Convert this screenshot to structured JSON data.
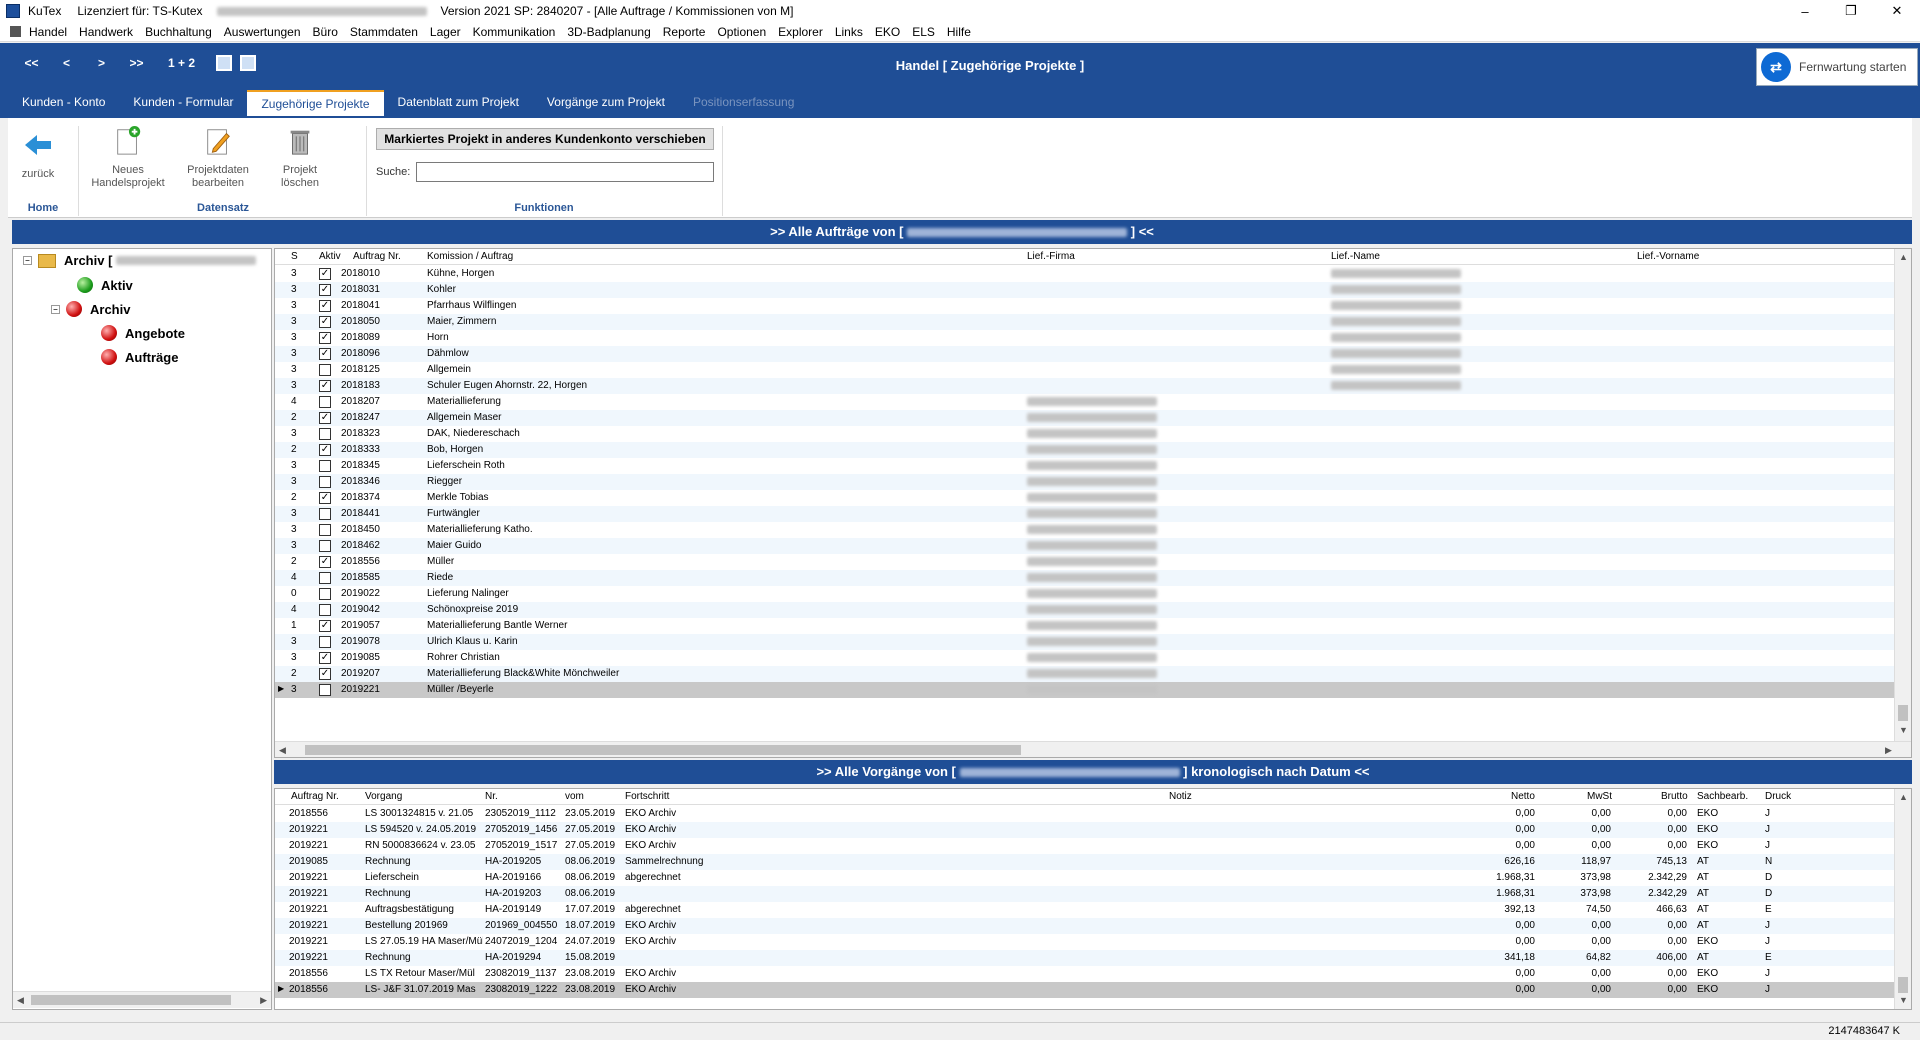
{
  "app": {
    "name": "KuTex",
    "license": "Lizenziert für: TS-Kutex",
    "version": "Version 2021 SP: 2840207 - [Alle Auftrage / Kommissionen von M]"
  },
  "menu": [
    "Handel",
    "Handwerk",
    "Buchhaltung",
    "Auswertungen",
    "Büro",
    "Stammdaten",
    "Lager",
    "Kommunikation",
    "3D-Badplanung",
    "Reporte",
    "Optionen",
    "Explorer",
    "Links",
    "EKO",
    "ELS",
    "Hilfe"
  ],
  "nav": {
    "first": "<<",
    "prev": "<",
    "next": ">",
    "last": ">>",
    "page": "1 + 2"
  },
  "header_title": "Handel   [ Zugehörige Projekte ]",
  "remote_label": "Fernwartung starten",
  "tabs": [
    {
      "label": "Kunden - Konto"
    },
    {
      "label": "Kunden - Formular"
    },
    {
      "label": "Zugehörige Projekte",
      "active": true
    },
    {
      "label": "Datenblatt zum Projekt"
    },
    {
      "label": "Vorgänge zum Projekt"
    },
    {
      "label": "Positionserfassung",
      "disabled": true
    }
  ],
  "ribbon": {
    "back": "zurück",
    "new_project": [
      "Neues",
      "Handelsprojekt"
    ],
    "edit_project": [
      "Projektdaten",
      "bearbeiten"
    ],
    "delete_project": [
      "Projekt",
      "löschen"
    ],
    "move_button": "Markiertes Projekt in anderes Kundenkonto verschieben",
    "search_label": "Suche:",
    "search_value": "",
    "groups": {
      "home": "Home",
      "record": "Datensatz",
      "functions": "Funktionen"
    }
  },
  "orders_header": {
    "prefix": ">> Alle Aufträge von [",
    "suffix": "] <<"
  },
  "tree": {
    "root": "Archiv [",
    "children": [
      "Aktiv",
      "Archiv"
    ],
    "archiv_children": [
      "Angebote",
      "Aufträge"
    ]
  },
  "orders": {
    "columns": [
      "S",
      "Aktiv",
      "Auftrag Nr.",
      "Komission / Auftrag",
      "Lief.-Firma",
      "Lief.-Name",
      "Lief.-Vorname"
    ],
    "rows": [
      {
        "s": "3",
        "aktiv": true,
        "nr": "2018010",
        "kom": "Kühne, Horgen",
        "redact": "name"
      },
      {
        "s": "3",
        "aktiv": true,
        "nr": "2018031",
        "kom": "Kohler",
        "redact": "name"
      },
      {
        "s": "3",
        "aktiv": true,
        "nr": "2018041",
        "kom": "Pfarrhaus Wilflingen",
        "redact": "name"
      },
      {
        "s": "3",
        "aktiv": true,
        "nr": "2018050",
        "kom": "Maier, Zimmern",
        "redact": "name"
      },
      {
        "s": "3",
        "aktiv": true,
        "nr": "2018089",
        "kom": "Horn",
        "redact": "name"
      },
      {
        "s": "3",
        "aktiv": true,
        "nr": "2018096",
        "kom": "Dähmlow",
        "redact": "name"
      },
      {
        "s": "3",
        "aktiv": false,
        "nr": "2018125",
        "kom": "Allgemein",
        "redact": "name"
      },
      {
        "s": "3",
        "aktiv": true,
        "nr": "2018183",
        "kom": "Schuler  Eugen Ahornstr. 22, Horgen",
        "redact": "name"
      },
      {
        "s": "4",
        "aktiv": false,
        "nr": "2018207",
        "kom": "Materiallieferung",
        "redact": "firma"
      },
      {
        "s": "2",
        "aktiv": true,
        "nr": "2018247",
        "kom": "Allgemein Maser",
        "redact": "firma"
      },
      {
        "s": "3",
        "aktiv": false,
        "nr": "2018323",
        "kom": "DAK, Niedereschach",
        "redact": "firma"
      },
      {
        "s": "2",
        "aktiv": true,
        "nr": "2018333",
        "kom": "Bob, Horgen",
        "redact": "firma"
      },
      {
        "s": "3",
        "aktiv": false,
        "nr": "2018345",
        "kom": "Lieferschein Roth",
        "redact": "firma"
      },
      {
        "s": "3",
        "aktiv": false,
        "nr": "2018346",
        "kom": "Riegger",
        "redact": "firma"
      },
      {
        "s": "2",
        "aktiv": true,
        "nr": "2018374",
        "kom": "Merkle Tobias",
        "redact": "firma"
      },
      {
        "s": "3",
        "aktiv": false,
        "nr": "2018441",
        "kom": "Furtwängler",
        "redact": "firma"
      },
      {
        "s": "3",
        "aktiv": false,
        "nr": "2018450",
        "kom": "Materiallieferung Katho.",
        "redact": "firma"
      },
      {
        "s": "3",
        "aktiv": false,
        "nr": "2018462",
        "kom": "Maier Guido",
        "redact": "firma"
      },
      {
        "s": "2",
        "aktiv": true,
        "nr": "2018556",
        "kom": "Müller",
        "redact": "firma"
      },
      {
        "s": "4",
        "aktiv": false,
        "nr": "2018585",
        "kom": "Riede",
        "redact": "firma"
      },
      {
        "s": "0",
        "aktiv": false,
        "nr": "2019022",
        "kom": "Lieferung Nalinger",
        "redact": "firma"
      },
      {
        "s": "4",
        "aktiv": false,
        "nr": "2019042",
        "kom": "Schönoxpreise 2019",
        "redact": "firma"
      },
      {
        "s": "1",
        "aktiv": true,
        "nr": "2019057",
        "kom": "Materiallieferung Bantle Werner",
        "redact": "firma"
      },
      {
        "s": "3",
        "aktiv": false,
        "nr": "2019078",
        "kom": "Ulrich Klaus u. Karin",
        "redact": "firma"
      },
      {
        "s": "3",
        "aktiv": true,
        "nr": "2019085",
        "kom": "Rohrer Christian",
        "redact": "firma"
      },
      {
        "s": "2",
        "aktiv": true,
        "nr": "2019207",
        "kom": "Materiallieferung Black&White Mönchweiler",
        "redact": "firma"
      },
      {
        "s": "3",
        "aktiv": false,
        "nr": "2019221",
        "kom": "Müller /Beyerle",
        "redact": "firma",
        "selected": true
      }
    ]
  },
  "vorgaenge_header": {
    "prefix": ">> Alle Vorgänge von [",
    "suffix": "] kronologisch nach Datum <<"
  },
  "vorgaenge": {
    "columns": [
      "Auftrag Nr.",
      "Vorgang",
      "Nr.",
      "vom",
      "Fortschritt",
      "Notiz",
      "Netto",
      "MwSt",
      "Brutto",
      "Sachbearb.",
      "Druck"
    ],
    "rows": [
      {
        "auftrag": "2018556",
        "vorgang": "LS 3001324815 v. 21.05",
        "nr": "23052019_1112",
        "vom": "23.05.2019",
        "fort": "EKO Archiv",
        "netto": "0,00",
        "mwst": "0,00",
        "brutto": "0,00",
        "sach": "EKO",
        "druck": "J"
      },
      {
        "auftrag": "2019221",
        "vorgang": "LS 594520 v. 24.05.2019",
        "nr": "27052019_1456",
        "vom": "27.05.2019",
        "fort": "EKO Archiv",
        "netto": "0,00",
        "mwst": "0,00",
        "brutto": "0,00",
        "sach": "EKO",
        "druck": "J"
      },
      {
        "auftrag": "2019221",
        "vorgang": "RN 5000836624 v. 23.05",
        "nr": "27052019_1517",
        "vom": "27.05.2019",
        "fort": "EKO Archiv",
        "netto": "0,00",
        "mwst": "0,00",
        "brutto": "0,00",
        "sach": "EKO",
        "druck": "J"
      },
      {
        "auftrag": "2019085",
        "vorgang": "Rechnung",
        "nr": "HA-2019205",
        "vom": "08.06.2019",
        "fort": "Sammelrechnung",
        "netto": "626,16",
        "mwst": "118,97",
        "brutto": "745,13",
        "sach": "AT",
        "druck": "N"
      },
      {
        "auftrag": "2019221",
        "vorgang": "Lieferschein",
        "nr": "HA-2019166",
        "vom": "08.06.2019",
        "fort": "abgerechnet",
        "netto": "1.968,31",
        "mwst": "373,98",
        "brutto": "2.342,29",
        "sach": "AT",
        "druck": "D"
      },
      {
        "auftrag": "2019221",
        "vorgang": "Rechnung",
        "nr": "HA-2019203",
        "vom": "08.06.2019",
        "fort": "",
        "netto": "1.968,31",
        "mwst": "373,98",
        "brutto": "2.342,29",
        "sach": "AT",
        "druck": "D"
      },
      {
        "auftrag": "2019221",
        "vorgang": "Auftragsbestätigung",
        "nr": "HA-2019149",
        "vom": "17.07.2019",
        "fort": "abgerechnet",
        "netto": "392,13",
        "mwst": "74,50",
        "brutto": "466,63",
        "sach": "AT",
        "druck": "E"
      },
      {
        "auftrag": "2019221",
        "vorgang": "Bestellung 201969",
        "nr": "201969_004550",
        "vom": "18.07.2019",
        "fort": "EKO Archiv",
        "netto": "0,00",
        "mwst": "0,00",
        "brutto": "0,00",
        "sach": "AT",
        "druck": "J"
      },
      {
        "auftrag": "2019221",
        "vorgang": "LS 27.05.19 HA Maser/Mül",
        "nr": "24072019_1204",
        "vom": "24.07.2019",
        "fort": "EKO Archiv",
        "netto": "0,00",
        "mwst": "0,00",
        "brutto": "0,00",
        "sach": "EKO",
        "druck": "J"
      },
      {
        "auftrag": "2019221",
        "vorgang": "Rechnung",
        "nr": "HA-2019294",
        "vom": "15.08.2019",
        "fort": "",
        "netto": "341,18",
        "mwst": "64,82",
        "brutto": "406,00",
        "sach": "AT",
        "druck": "E"
      },
      {
        "auftrag": "2018556",
        "vorgang": "LS TX Retour Maser/Mül",
        "nr": "23082019_1137",
        "vom": "23.08.2019",
        "fort": "EKO Archiv",
        "netto": "0,00",
        "mwst": "0,00",
        "brutto": "0,00",
        "sach": "EKO",
        "druck": "J"
      },
      {
        "auftrag": "2018556",
        "vorgang": "LS- J&F 31.07.2019 Mas",
        "nr": "23082019_1222",
        "vom": "23.08.2019",
        "fort": "EKO Archiv",
        "netto": "0,00",
        "mwst": "0,00",
        "brutto": "0,00",
        "sach": "EKO",
        "druck": "J",
        "selected": true
      }
    ]
  },
  "status": "2147483647 K",
  "colors": {
    "accent": "#1f4e96",
    "tab_indicator": "#f0a020",
    "row_alt": "#f0f7fd",
    "row_selected": "#c8c8c8"
  }
}
